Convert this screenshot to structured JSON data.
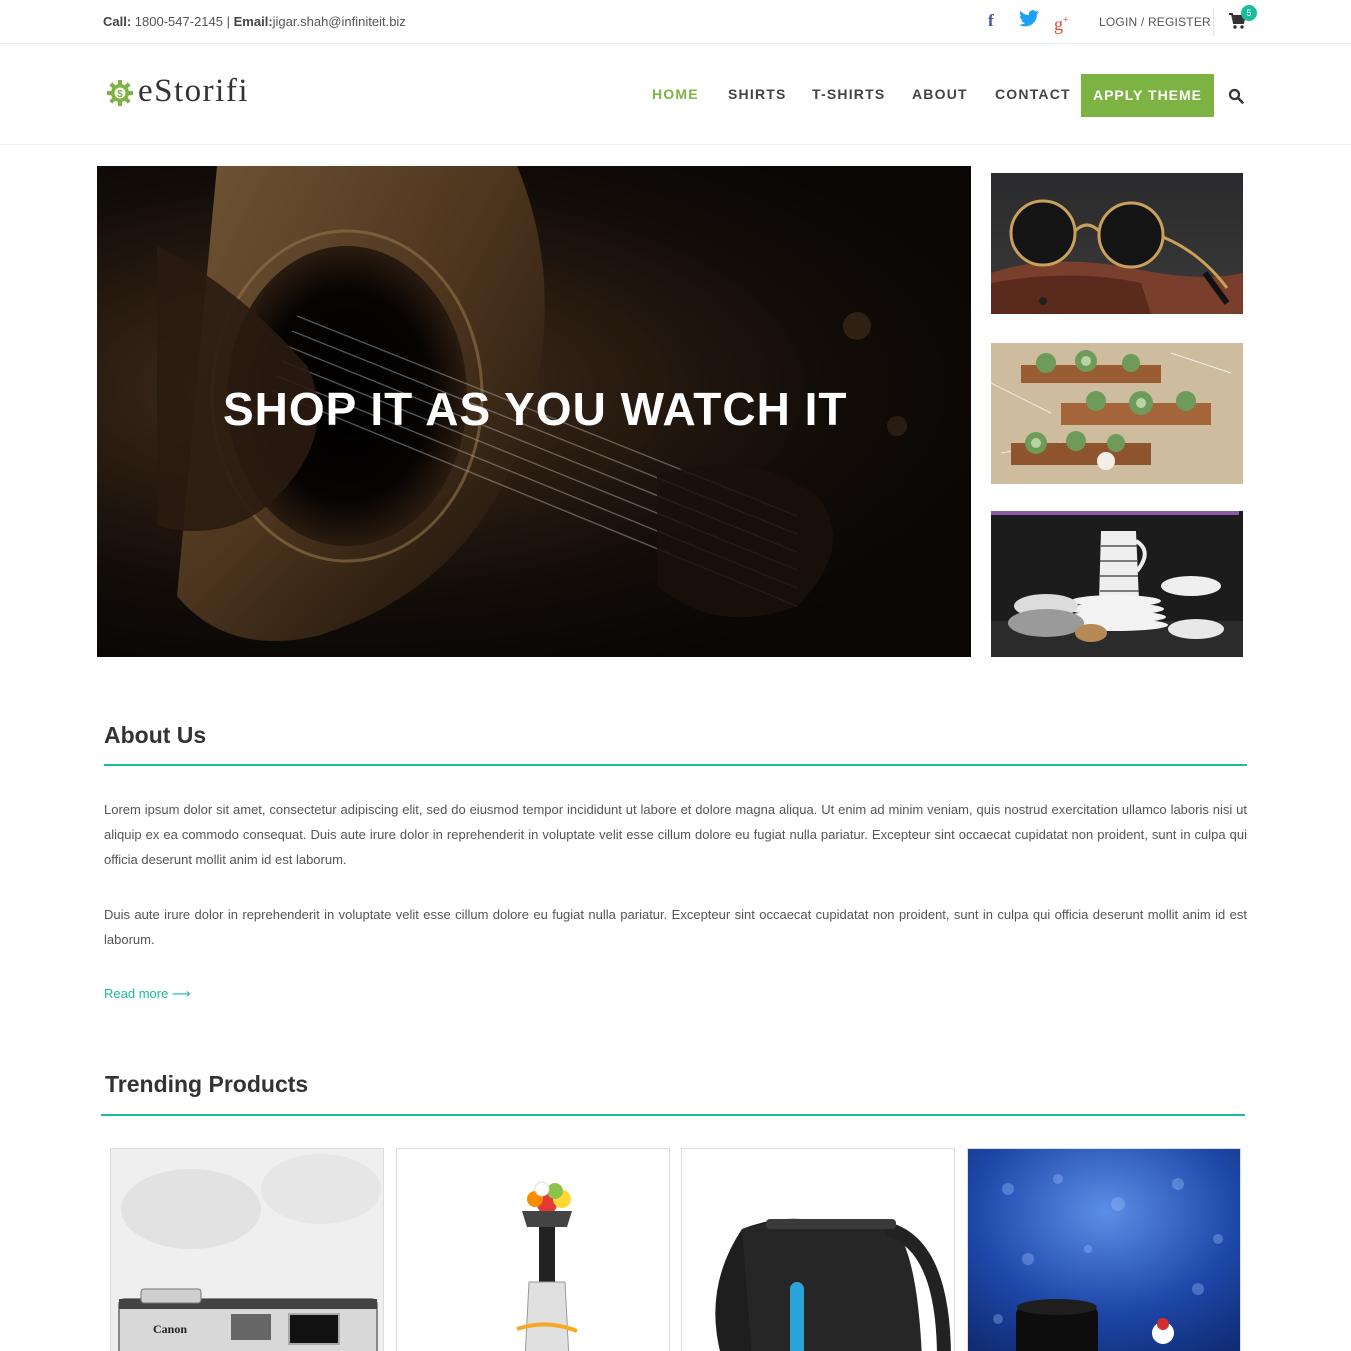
{
  "topbar": {
    "call_label": "Call:",
    "call_value": "1800-547-2145",
    "divider": "|",
    "email_label": "Email:",
    "email_value": "jigar.shah@infiniteit.biz",
    "social": [
      "facebook-icon",
      "twitter-icon",
      "google-plus-icon"
    ],
    "login": "LOGIN / REGISTER",
    "cart_count": "5"
  },
  "header": {
    "logo": "eStorifi",
    "nav": [
      "HOME",
      "SHIRTS",
      "T-SHIRTS",
      "ABOUT",
      "CONTACT"
    ],
    "apply_theme": "APPLY THEME"
  },
  "hero": {
    "title": "SHOP IT AS YOU WATCH IT"
  },
  "about": {
    "title": "About Us",
    "para1": "Lorem ipsum dolor sit amet, consectetur adipiscing elit, sed do eiusmod tempor incididunt ut labore et dolore magna aliqua. Ut enim ad minim veniam, quis nostrud exercitation ullamco laboris nisi ut aliquip ex ea commodo consequat. Duis aute irure dolor in reprehenderit in voluptate velit esse cillum dolore eu fugiat nulla pariatur. Excepteur sint occaecat cupidatat non proident, sunt in culpa qui officia deserunt mollit anim id est laborum.",
    "para2": "Duis aute irure dolor in reprehenderit in voluptate velit esse cillum dolore eu fugiat nulla pariatur. Excepteur sint occaecat cupidatat non proident, sunt in culpa qui officia deserunt mollit anim id est laborum.",
    "read_more": "Read more ⟶"
  },
  "trending": {
    "title": "Trending Products",
    "camera_brand": "Canon"
  },
  "colors": {
    "accent_green": "#7cb342",
    "teal": "#1abc9c"
  }
}
